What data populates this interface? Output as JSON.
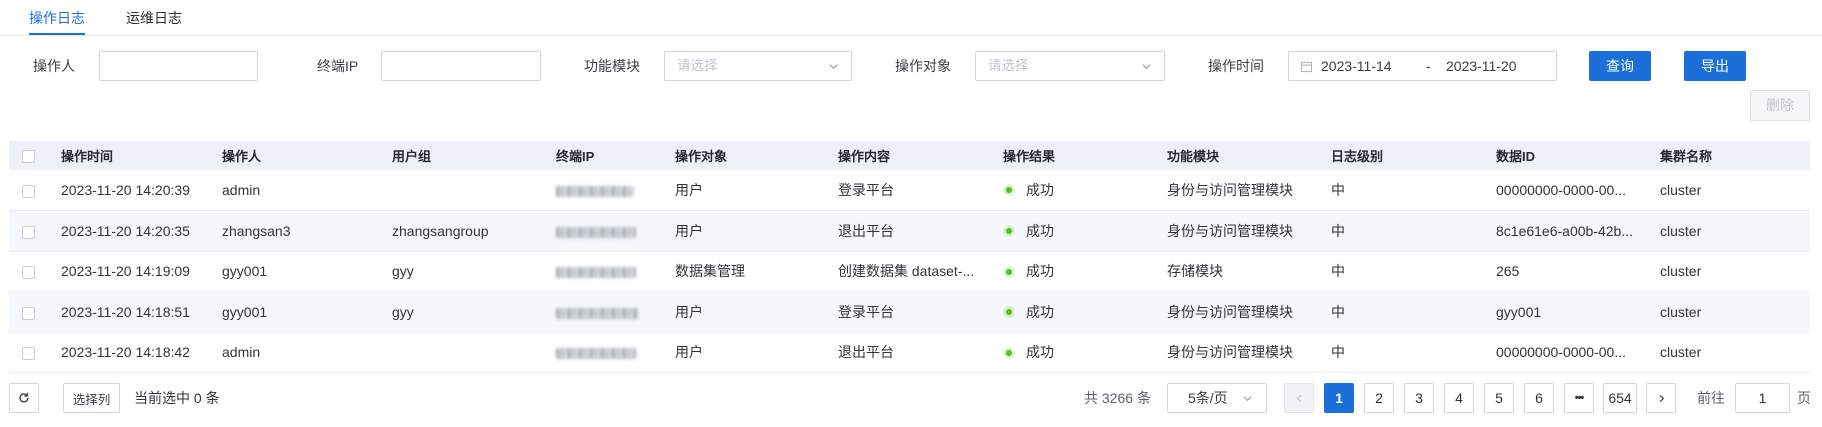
{
  "tabs": [
    {
      "label": "操作日志",
      "active": true
    },
    {
      "label": "运维日志",
      "active": false
    }
  ],
  "filters": {
    "operator": {
      "label": "操作人",
      "value": ""
    },
    "terminal_ip": {
      "label": "终端IP",
      "value": ""
    },
    "module": {
      "label": "功能模块",
      "placeholder": "请选择",
      "icon": "chevron-down-icon"
    },
    "target": {
      "label": "操作对象",
      "placeholder": "请选择",
      "icon": "chevron-down-icon"
    },
    "time": {
      "label": "操作时间",
      "icon": "calendar-icon",
      "start": "2023-11-14",
      "separator": "-",
      "end": "2023-11-20"
    },
    "query_label": "查询",
    "export_label": "导出"
  },
  "toolbar": {
    "delete_label": "删除",
    "delete_disabled": true
  },
  "table": {
    "columns": [
      "操作时间",
      "操作人",
      "用户组",
      "终端IP",
      "操作对象",
      "操作内容",
      "操作结果",
      "功能模块",
      "日志级别",
      "数据ID",
      "集群名称"
    ],
    "rows": [
      {
        "time": "2023-11-20 14:20:39",
        "operator": "admin",
        "group": "",
        "target": "用户",
        "content": "登录平台",
        "result": "成功",
        "module": "身份与访问管理模块",
        "level": "中",
        "data_id": "00000000-0000-00...",
        "cluster": "cluster"
      },
      {
        "time": "2023-11-20 14:20:35",
        "operator": "zhangsan3",
        "group": "zhangsangroup",
        "target": "用户",
        "content": "退出平台",
        "result": "成功",
        "module": "身份与访问管理模块",
        "level": "中",
        "data_id": "8c1e61e6-a00b-42b...",
        "cluster": "cluster"
      },
      {
        "time": "2023-11-20 14:19:09",
        "operator": "gyy001",
        "group": "gyy",
        "target": "数据集管理",
        "content": "创建数据集 dataset-...",
        "result": "成功",
        "module": "存储模块",
        "level": "中",
        "data_id": "265",
        "cluster": "cluster"
      },
      {
        "time": "2023-11-20 14:18:51",
        "operator": "gyy001",
        "group": "gyy",
        "target": "用户",
        "content": "登录平台",
        "result": "成功",
        "module": "身份与访问管理模块",
        "level": "中",
        "data_id": "gyy001",
        "cluster": "cluster"
      },
      {
        "time": "2023-11-20 14:18:42",
        "operator": "admin",
        "group": "",
        "target": "用户",
        "content": "退出平台",
        "result": "成功",
        "module": "身份与访问管理模块",
        "level": "中",
        "data_id": "00000000-0000-00...",
        "cluster": "cluster"
      }
    ]
  },
  "footer": {
    "refresh_icon": "refresh-icon",
    "columns_label": "选择列",
    "selected_prefix": "当前选中",
    "selected_count": "0",
    "selected_suffix": "条",
    "total_prefix": "共",
    "total_count": "3266",
    "total_suffix": "条",
    "page_size": "5条/页",
    "prev_icon": "chevron-left-icon",
    "prev_disabled": true,
    "pages": [
      "1",
      "2",
      "3",
      "4",
      "5",
      "6"
    ],
    "current_page": 1,
    "ellipsis": "•••",
    "last_page": "654",
    "next_icon": "chevron-right-icon",
    "goto_label": "前往",
    "goto_value": "1",
    "goto_suffix": "页"
  },
  "colors": {
    "primary": "#1a6fd8",
    "success": "#52c41a",
    "header_bg": "#edf1f7",
    "stripe_bg": "#f4f7fb"
  }
}
